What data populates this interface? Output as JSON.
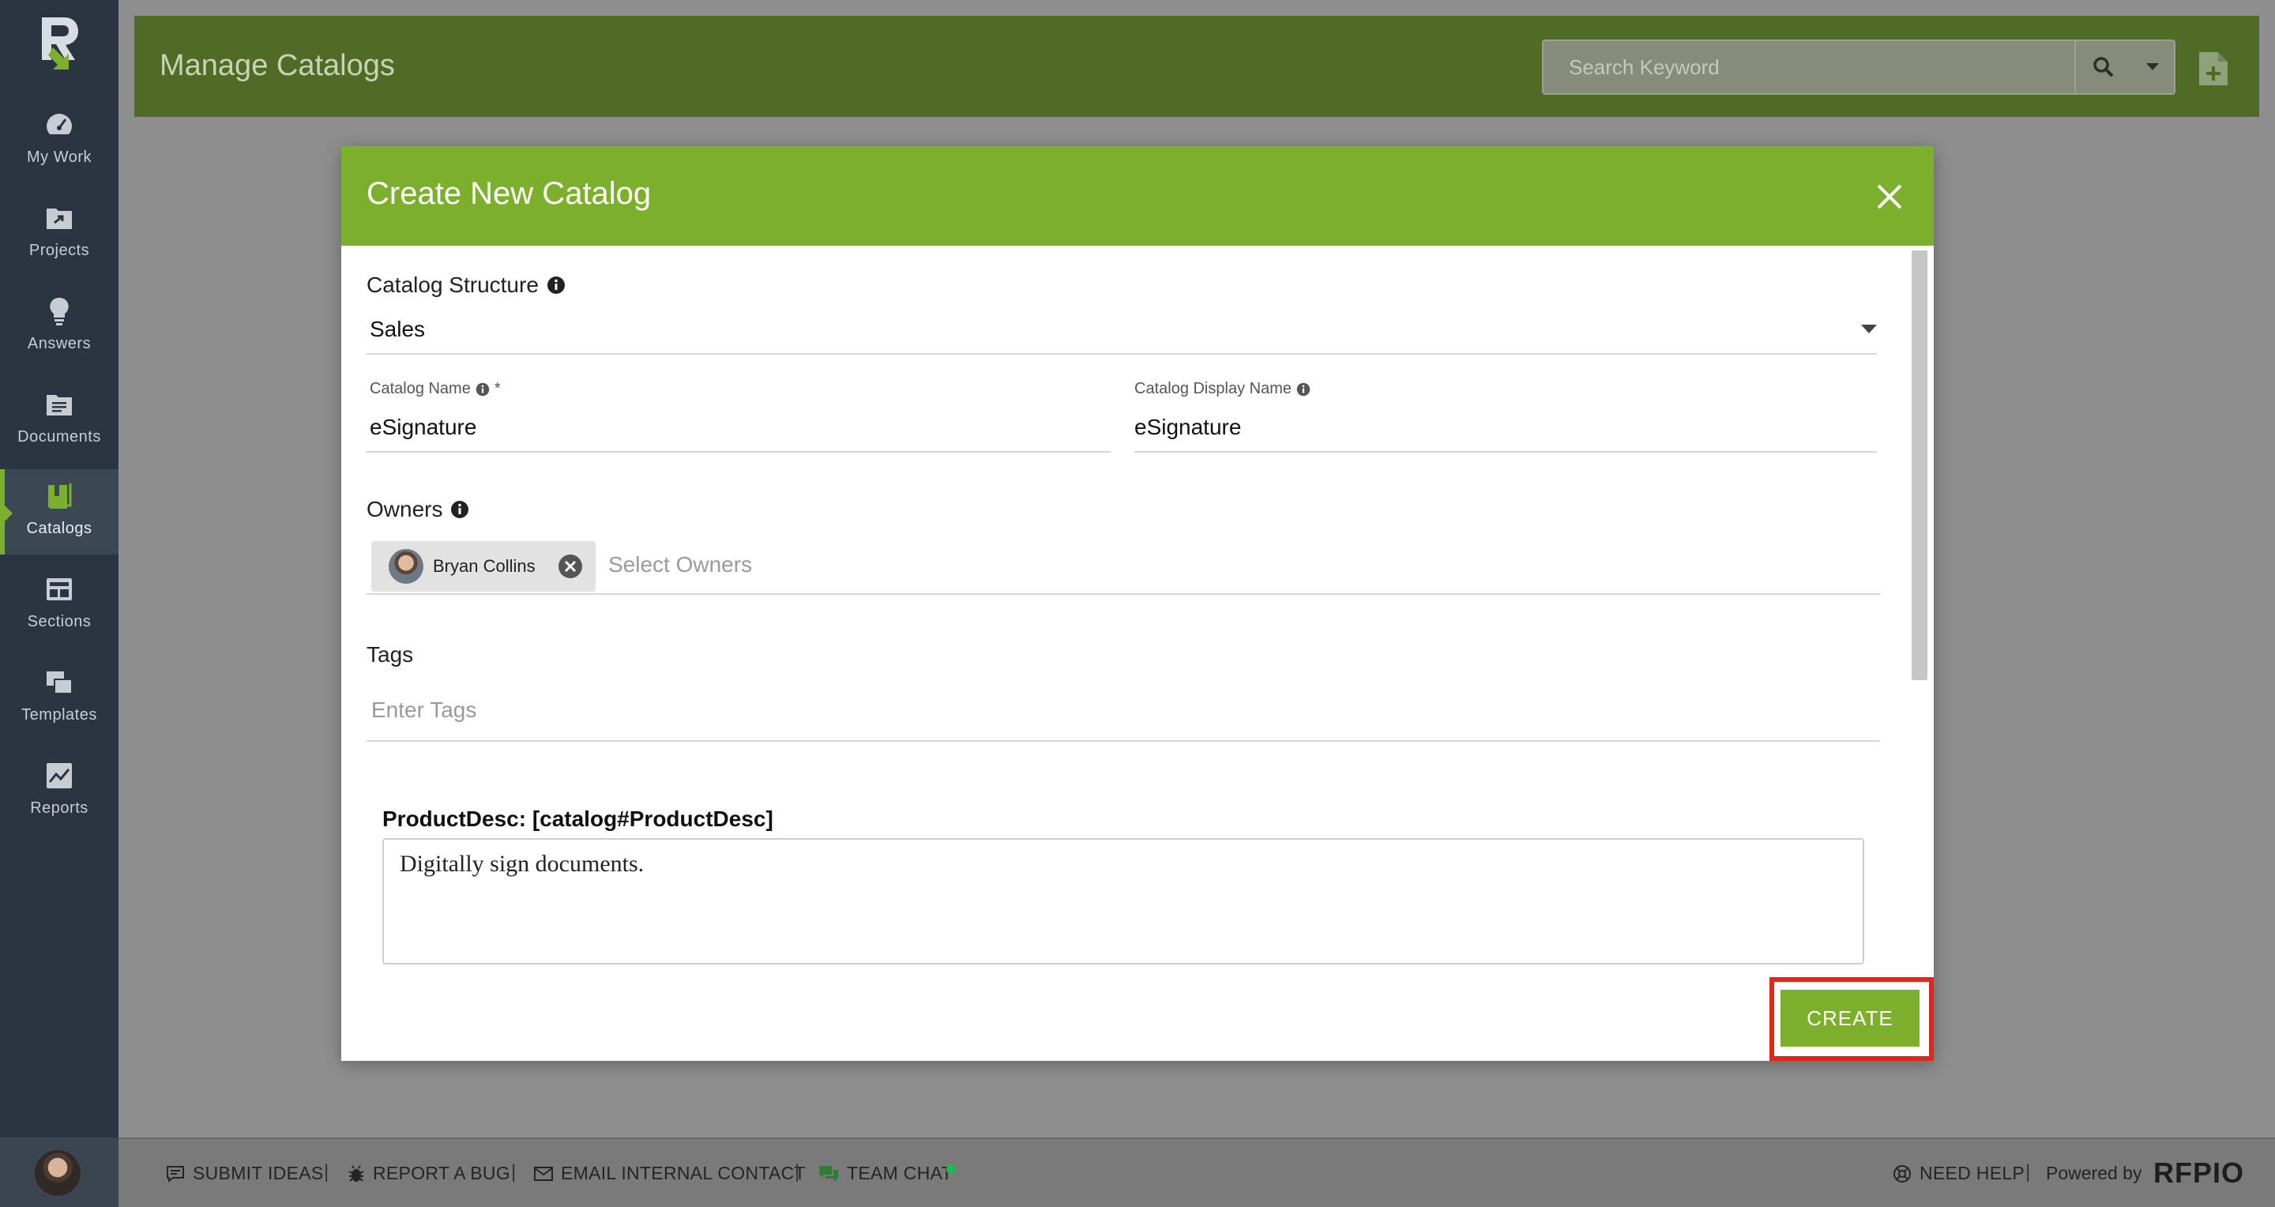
{
  "sidebar": {
    "items": [
      {
        "label": "My Work",
        "icon": "dashboard-icon"
      },
      {
        "label": "Projects",
        "icon": "projects-icon"
      },
      {
        "label": "Answers",
        "icon": "lightbulb-icon"
      },
      {
        "label": "Documents",
        "icon": "documents-icon"
      },
      {
        "label": "Catalogs",
        "icon": "catalog-icon",
        "active": true
      },
      {
        "label": "Sections",
        "icon": "sections-icon"
      },
      {
        "label": "Templates",
        "icon": "templates-icon"
      },
      {
        "label": "Reports",
        "icon": "reports-icon"
      }
    ]
  },
  "header": {
    "title": "Manage Catalogs",
    "search_placeholder": "Search Keyword"
  },
  "modal": {
    "title": "Create New Catalog",
    "catalog_structure_label": "Catalog Structure",
    "catalog_structure_value": "Sales",
    "catalog_name_label": "Catalog Name",
    "catalog_name_required": "*",
    "catalog_name_value": "eSignature",
    "catalog_display_name_label": "Catalog Display Name",
    "catalog_display_name_value": "eSignature",
    "owners_label": "Owners",
    "owner_chip_name": "Bryan Collins",
    "owners_placeholder": "Select Owners",
    "tags_label": "Tags",
    "tags_placeholder": "Enter Tags",
    "product_desc_label": "ProductDesc: [catalog#ProductDesc]",
    "product_desc_value": "Digitally sign documents.",
    "create_label": "CREATE"
  },
  "footer": {
    "submit_ideas": "SUBMIT IDEAS",
    "report_bug": "REPORT A BUG",
    "email_contact": "EMAIL INTERNAL CONTACT",
    "team_chat": "TEAM CHAT",
    "need_help": "NEED HELP",
    "powered_by": "Powered by",
    "brand": "RFPIO",
    "separator": "|"
  },
  "colors": {
    "accent": "#7cb02c",
    "sidebar": "#2a3541",
    "highlight": "#e1261c"
  }
}
